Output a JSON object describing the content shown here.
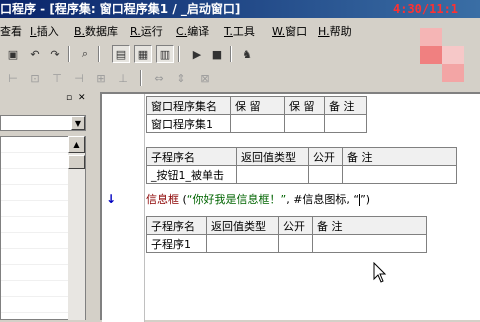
{
  "window": {
    "title": "口程序 - [程序集: 窗口程序集1 / _启动窗口]",
    "clock": "4:30/11:1"
  },
  "menubar": {
    "items": [
      {
        "key": "",
        "label": "查看"
      },
      {
        "key": "I.",
        "label": "插入"
      },
      {
        "key": "B.",
        "label": "数据库"
      },
      {
        "key": "R.",
        "label": "运行"
      },
      {
        "key": "C.",
        "label": "编译"
      },
      {
        "key": "T.",
        "label": "工具"
      },
      {
        "key": "W.",
        "label": "窗口"
      },
      {
        "key": "H.",
        "label": "帮助"
      }
    ]
  },
  "toolbar": {
    "icons": [
      "save-icon",
      "undo-icon",
      "redo-icon",
      "find-icon",
      "layout-icon",
      "grid-icon",
      "table-icon",
      "run-icon",
      "stop-icon",
      "debug-icon"
    ]
  },
  "table1": {
    "headers": [
      "窗口程序集名",
      "保 留",
      "保 留",
      "备 注"
    ],
    "row": [
      "窗口程序集1",
      "",
      "",
      ""
    ]
  },
  "table2": {
    "headers": [
      "子程序名",
      "返回值类型",
      "公开",
      "备 注"
    ],
    "row": [
      "_按钮1_被单击",
      "",
      "",
      ""
    ]
  },
  "code": {
    "func": "信息框",
    "open": " (",
    "str": "“你好我是信息框！”",
    "rest": ", #信息图标, “",
    "close": "”)"
  },
  "table3": {
    "headers": [
      "子程序名",
      "返回值类型",
      "公开",
      "备 注"
    ],
    "row": [
      "子程序1",
      "",
      "",
      ""
    ]
  },
  "colors": {
    "titlebar_start": "#0a246a",
    "titlebar_end": "#3a6ea5",
    "clock": "#ff3030",
    "func": "#8b0000",
    "string": "#006400",
    "pixel_pink": "#f08080"
  }
}
